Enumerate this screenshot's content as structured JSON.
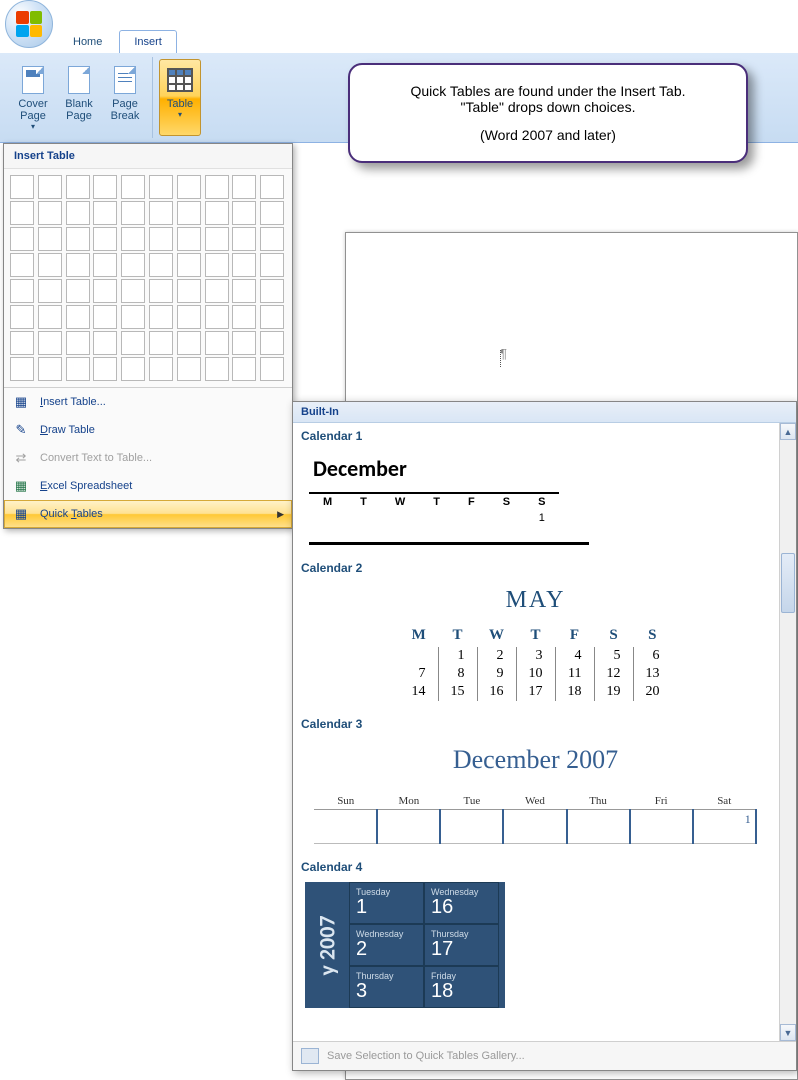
{
  "ribbon": {
    "tabs": {
      "home": "Home",
      "insert": "Insert"
    },
    "buttons": {
      "cover_page": "Cover\nPage",
      "blank_page": "Blank\nPage",
      "page_break": "Page\nBreak",
      "table": "Table"
    }
  },
  "insert_table_panel": {
    "title": "Insert Table",
    "menu": {
      "insert_table": "Insert Table...",
      "draw_table": "Draw Table",
      "convert": "Convert Text to Table...",
      "excel": "Excel Spreadsheet",
      "quick_tables": "Quick Tables"
    }
  },
  "callout": {
    "line1": "Quick Tables are found under the Insert Tab.",
    "line2": "\"Table\" drops down choices.",
    "line3": "(Word 2007 and later)"
  },
  "quick_tables": {
    "header": "Built-In",
    "footer": "Save Selection to Quick Tables Gallery...",
    "items": {
      "cal1": {
        "label": "Calendar 1",
        "month": "December",
        "days": [
          "M",
          "T",
          "W",
          "T",
          "F",
          "S",
          "S"
        ],
        "firstrow": [
          "",
          "",
          "",
          "",
          "",
          "",
          "1"
        ]
      },
      "cal2": {
        "label": "Calendar 2",
        "month": "MAY",
        "days": [
          "M",
          "T",
          "W",
          "T",
          "F",
          "S",
          "S"
        ],
        "rows": [
          [
            "",
            "1",
            "2",
            "3",
            "4",
            "5",
            "6"
          ],
          [
            "7",
            "8",
            "9",
            "10",
            "11",
            "12",
            "13"
          ],
          [
            "14",
            "15",
            "16",
            "17",
            "18",
            "19",
            "20"
          ]
        ]
      },
      "cal3": {
        "label": "Calendar 3",
        "title": "December 2007",
        "days": [
          "Sun",
          "Mon",
          "Tue",
          "Wed",
          "Thu",
          "Fri",
          "Sat"
        ],
        "row1": [
          "",
          "",
          "",
          "",
          "",
          "",
          "1"
        ]
      },
      "cal4": {
        "label": "Calendar 4",
        "year": "y 2007",
        "cells": [
          {
            "dow": "Tuesday",
            "num": "1"
          },
          {
            "dow": "Wednesday",
            "num": "16"
          },
          {
            "dow": "Wednesday",
            "num": "2"
          },
          {
            "dow": "Thursday",
            "num": "17"
          },
          {
            "dow": "Thursday",
            "num": "3"
          },
          {
            "dow": "Friday",
            "num": "18"
          }
        ]
      }
    }
  }
}
